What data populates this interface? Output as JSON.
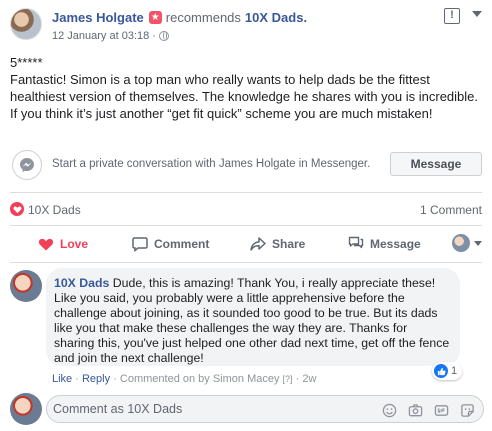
{
  "post": {
    "author": "James Holgate",
    "action_text": "recommends",
    "page_name": "10X Dads.",
    "timestamp": "12 January at 03:18",
    "separator": "·",
    "flag_glyph": "!",
    "rating": "5*****",
    "review_text": "Fantastic! Simon is a top man who really wants to help dads be the fittest healthiest version of themselves. The knowledge he shares with you is incredible. If you think it’s just another “get fit quick” scheme you are much mistaken!"
  },
  "messenger": {
    "prompt": "Start a private conversation with James Holgate in Messenger.",
    "button_label": "Message"
  },
  "stats": {
    "reactor": "10X Dads",
    "comments": "1 Comment"
  },
  "actions": {
    "love": "Love",
    "comment": "Comment",
    "share": "Share",
    "message": "Message"
  },
  "comment": {
    "author": "10X Dads",
    "text": "Dude, this is amazing! Thank You, i really appreciate these! Like you said, you probably were a little apprehensive before the challenge about joining, as it sounded too good to be true. But its dads like you that make these challenges the way they are. Thanks for sharing this, you've just helped one other dad next time, get off the fence and join the next challenge!",
    "like_link": "Like",
    "dot": "·",
    "reply_link": "Reply",
    "commented_on_by": "· Commented on by Simon Macey",
    "help_marker": "[?]",
    "age": "· 2w",
    "like_count": "1"
  },
  "compose": {
    "placeholder": "Comment as 10X Dads"
  },
  "icons": {
    "recommend_badge": "star-icon",
    "privacy": "globe-icon",
    "messenger": "messenger-icon",
    "reaction": "heart-icon",
    "comment_like": "thumbs-up-icon",
    "compose_tools": [
      "emoji-icon",
      "camera-icon",
      "gif-icon",
      "sticker-icon"
    ]
  },
  "colors": {
    "link": "#385898",
    "love": "#f33e58",
    "like": "#1877f2",
    "recommend_badge": "#f35369",
    "text_secondary": "#606770"
  }
}
